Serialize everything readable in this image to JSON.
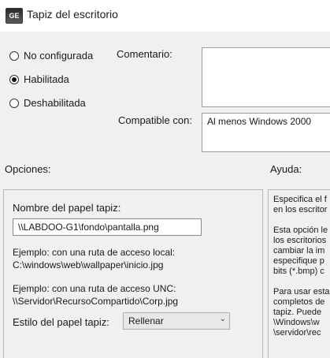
{
  "window": {
    "title": "Tapiz del escritorio",
    "icon_label": "GE"
  },
  "state": {
    "options": [
      {
        "label": "No configurada",
        "checked": false
      },
      {
        "label": "Habilitada",
        "checked": true
      },
      {
        "label": "Deshabilitada",
        "checked": false
      }
    ]
  },
  "comment": {
    "label": "Comentario:",
    "value": ""
  },
  "compatible": {
    "label": "Compatible con:",
    "value": "Al menos Windows 2000"
  },
  "options_section": {
    "label": "Opciones:",
    "wallpaper_name_label": "Nombre del papel tapiz:",
    "wallpaper_path": "\\\\LABDOO-G1\\fondo\\pantalla.png",
    "example_local_label": "Ejemplo: con una ruta de acceso local:",
    "example_local_value": "C:\\windows\\web\\wallpaper\\inicio.jpg",
    "example_unc_label": "Ejemplo: con una ruta de acceso UNC:",
    "example_unc_value": "\\\\Servidor\\RecursoCompartido\\Corp.jpg",
    "style_label": "Estilo del papel tapiz:",
    "style_value": "Rellenar"
  },
  "help_section": {
    "label": "Ayuda:",
    "lines": [
      "Especifica el f",
      "en los escritor",
      "",
      "Esta opción le",
      "los escritorios",
      "cambiar la im",
      "especifique p",
      "bits (*.bmp) c",
      "",
      "Para usar esta",
      "completos de",
      "tapiz. Puede",
      "\\Windows\\w",
      "\\servidor\\rec"
    ]
  }
}
